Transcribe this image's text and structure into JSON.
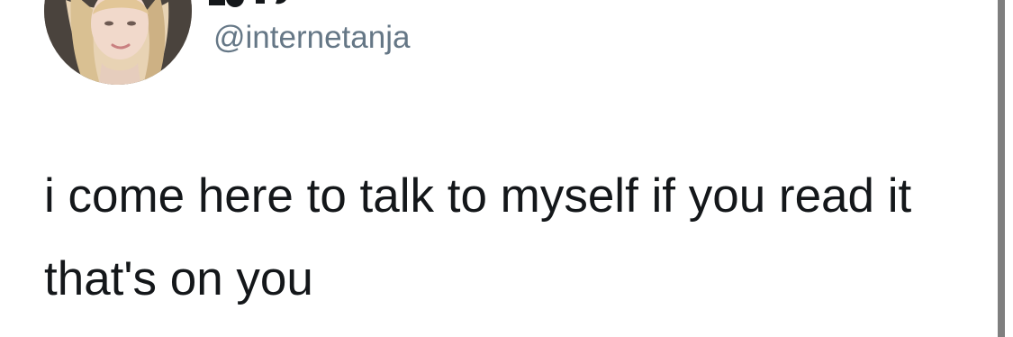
{
  "tweet": {
    "author": {
      "handle": "@internetanja",
      "avatar_icon": "profile-photo-avatar"
    },
    "text": "i come here to talk to myself if you read it that's on you"
  },
  "colors": {
    "background": "#ffffff",
    "handle": "#657786",
    "text": "#14171a",
    "edge": "#7f7f7f"
  }
}
